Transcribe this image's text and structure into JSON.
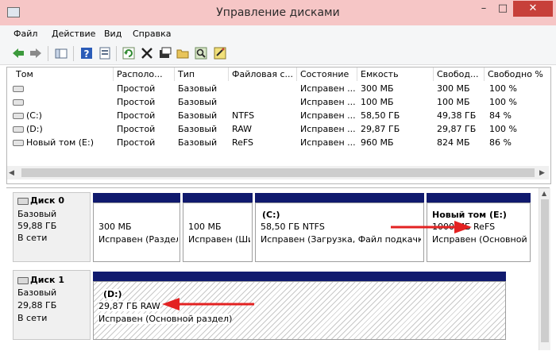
{
  "window": {
    "title": "Управление дисками",
    "minimize_glyph": "–",
    "maximize_glyph": "□",
    "close_glyph": "✕"
  },
  "menu": [
    "Файл",
    "Действие",
    "Вид",
    "Справка"
  ],
  "toolbar": {
    "icons": [
      "back-arrow-icon",
      "forward-arrow-icon",
      "console-tree-icon",
      "help-icon",
      "properties-icon",
      "refresh-icon",
      "delete-icon",
      "open-icon",
      "explore-icon",
      "search-icon",
      "wizard-icon"
    ]
  },
  "volume_list": {
    "columns": [
      "Том",
      "Располо...",
      "Тип",
      "Файловая с...",
      "Состояние",
      "Емкость",
      "Свобод...",
      "Свободно %"
    ],
    "rows": [
      {
        "name": "",
        "layout": "Простой",
        "type": "Базовый",
        "fs": "",
        "status": "Исправен ...",
        "capacity": "300 МБ",
        "free": "300 МБ",
        "free_pct": "100 %"
      },
      {
        "name": "",
        "layout": "Простой",
        "type": "Базовый",
        "fs": "",
        "status": "Исправен ...",
        "capacity": "100 МБ",
        "free": "100 МБ",
        "free_pct": "100 %"
      },
      {
        "name": "(C:)",
        "layout": "Простой",
        "type": "Базовый",
        "fs": "NTFS",
        "status": "Исправен ...",
        "capacity": "58,50 ГБ",
        "free": "49,38 ГБ",
        "free_pct": "84 %"
      },
      {
        "name": "(D:)",
        "layout": "Простой",
        "type": "Базовый",
        "fs": "RAW",
        "status": "Исправен ...",
        "capacity": "29,87 ГБ",
        "free": "29,87 ГБ",
        "free_pct": "100 %"
      },
      {
        "name": "Новый том (E:)",
        "layout": "Простой",
        "type": "Базовый",
        "fs": "ReFS",
        "status": "Исправен ...",
        "capacity": "960 МБ",
        "free": "824 МБ",
        "free_pct": "86 %"
      }
    ]
  },
  "disks": [
    {
      "name": "Диск 0",
      "type": "Базовый",
      "size": "59,88 ГБ",
      "state": "В сети",
      "partitions": [
        {
          "title": "",
          "line1": "300 МБ",
          "line2": "Исправен (Раздел"
        },
        {
          "title": "",
          "line1": "100 МБ",
          "line2": "Исправен (Ши"
        },
        {
          "title": "(C:)",
          "line1": "58,50 ГБ NTFS",
          "line2": "Исправен (Загрузка, Файл подкачки,"
        },
        {
          "title": "Новый том  (E:)",
          "line1": "1000 МБ ReFS",
          "line2": "Исправен (Основной р"
        }
      ]
    },
    {
      "name": "Диск 1",
      "type": "Базовый",
      "size": "29,88 ГБ",
      "state": "В сети",
      "partitions": [
        {
          "title": "(D:)",
          "line1": "29,87 ГБ RAW",
          "line2": "Исправен (Основной раздел)"
        }
      ]
    }
  ],
  "colors": {
    "titlebar": "#f6c6c6",
    "close_button": "#c7403a",
    "partition_cap": "#101a6e",
    "annotation_arrow": "#e32222"
  }
}
